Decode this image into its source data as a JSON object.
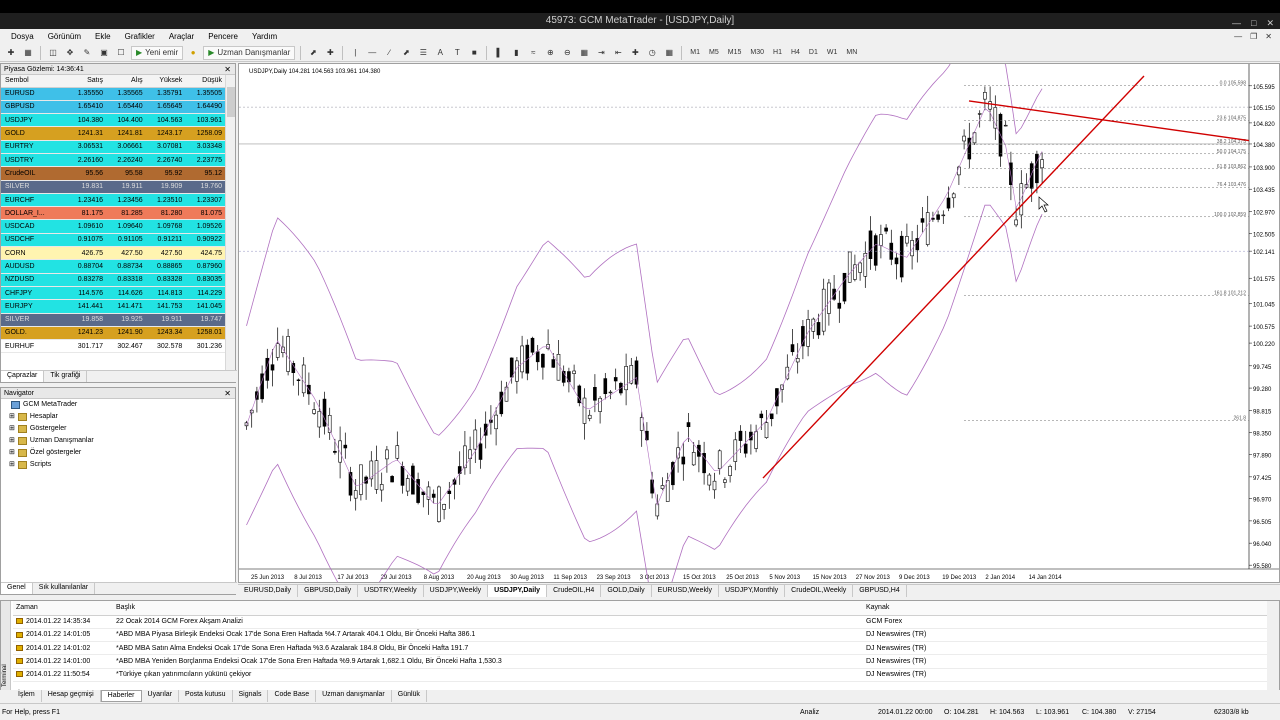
{
  "window": {
    "title": "45973: GCM MetaTrader - [USDJPY,Daily]"
  },
  "menu": [
    "Dosya",
    "Görünüm",
    "Ekle",
    "Grafikler",
    "Araçlar",
    "Pencere",
    "Yardım"
  ],
  "toolbar": {
    "new_order": "Yeni emir",
    "expert_advisors": "Uzman Danışmanlar",
    "timeframes": [
      "M1",
      "M5",
      "M15",
      "M30",
      "H1",
      "H4",
      "D1",
      "W1",
      "MN"
    ]
  },
  "market_watch": {
    "title": "Piyasa Gözlemi: 14:36:41",
    "headers": [
      "Sembol",
      "Satış",
      "Alış",
      "Yüksek",
      "Düşük"
    ],
    "rows": [
      {
        "sym": "EURUSD",
        "bid": "1.35550",
        "ask": "1.35565",
        "high": "1.35791",
        "low": "1.35505",
        "color": "#3fc0e8"
      },
      {
        "sym": "GBPUSD",
        "bid": "1.65410",
        "ask": "1.65440",
        "high": "1.65645",
        "low": "1.64490",
        "color": "#3fc0e8"
      },
      {
        "sym": "USDJPY",
        "bid": "104.380",
        "ask": "104.400",
        "high": "104.563",
        "low": "103.961",
        "color": "#22e3e3"
      },
      {
        "sym": "GOLD",
        "bid": "1241.31",
        "ask": "1241.81",
        "high": "1243.17",
        "low": "1258.09",
        "color": "#d6a020"
      },
      {
        "sym": "EURTRY",
        "bid": "3.06531",
        "ask": "3.06661",
        "high": "3.07081",
        "low": "3.03348",
        "color": "#22e3e3"
      },
      {
        "sym": "USDTRY",
        "bid": "2.26160",
        "ask": "2.26240",
        "high": "2.26740",
        "low": "2.23775",
        "color": "#22e3e3"
      },
      {
        "sym": "CrudeOIL",
        "bid": "95.56",
        "ask": "95.58",
        "high": "95.92",
        "low": "95.12",
        "color": "#b06a30"
      },
      {
        "sym": "SILVER",
        "bid": "19.831",
        "ask": "19.911",
        "high": "19.909",
        "low": "19.760",
        "color": "#5a6a8a"
      },
      {
        "sym": "EURCHF",
        "bid": "1.23416",
        "ask": "1.23456",
        "high": "1.23510",
        "low": "1.23307",
        "color": "#22e3e3"
      },
      {
        "sym": "DOLLAR_I...",
        "bid": "81.175",
        "ask": "81.285",
        "high": "81.280",
        "low": "81.075",
        "color": "#ef7a5a"
      },
      {
        "sym": "USDCAD",
        "bid": "1.09610",
        "ask": "1.09640",
        "high": "1.09768",
        "low": "1.09526",
        "color": "#22e3e3"
      },
      {
        "sym": "USDCHF",
        "bid": "0.91075",
        "ask": "0.91105",
        "high": "0.91211",
        "low": "0.90922",
        "color": "#22e3e3"
      },
      {
        "sym": "CORN",
        "bid": "426.75",
        "ask": "427.50",
        "high": "427.50",
        "low": "424.75",
        "color": "#fff4b0"
      },
      {
        "sym": "AUDUSD",
        "bid": "0.88704",
        "ask": "0.88734",
        "high": "0.88865",
        "low": "0.87960",
        "color": "#22e3e3"
      },
      {
        "sym": "NZDUSD",
        "bid": "0.83278",
        "ask": "0.83318",
        "high": "0.83328",
        "low": "0.83035",
        "color": "#22e3e3"
      },
      {
        "sym": "CHFJPY",
        "bid": "114.576",
        "ask": "114.626",
        "high": "114.813",
        "low": "114.229",
        "color": "#22e3e3"
      },
      {
        "sym": "EURJPY",
        "bid": "141.441",
        "ask": "141.471",
        "high": "141.753",
        "low": "141.045",
        "color": "#22e3e3"
      },
      {
        "sym": "SILVER",
        "bid": "19.858",
        "ask": "19.925",
        "high": "19.911",
        "low": "19.747",
        "color": "#5a6a8a"
      },
      {
        "sym": "GOLD.",
        "bid": "1241.23",
        "ask": "1241.90",
        "high": "1243.34",
        "low": "1258.01",
        "color": "#d6a020"
      },
      {
        "sym": "EURHUF",
        "bid": "301.717",
        "ask": "302.467",
        "high": "302.578",
        "low": "301.236",
        "color": "#ffffff"
      }
    ],
    "tabs": [
      "Çaprazlar",
      "Tik grafiği"
    ]
  },
  "navigator": {
    "title": "Navigator",
    "root": "GCM MetaTrader",
    "items": [
      "Hesaplar",
      "Göstergeler",
      "Uzman Danışmanlar",
      "Özel göstergeler",
      "Scripts"
    ],
    "tabs": [
      "Genel",
      "Sık kullanılanlar"
    ]
  },
  "chart": {
    "info": "USDJPY,Daily  104.281 104.563 103.961 104.380",
    "price_labels": [
      "105.595",
      "105.150",
      "104.820",
      "104.380",
      "103.900",
      "103.435",
      "102.970",
      "102.505",
      "102.141",
      "101.575",
      "101.045",
      "100.575",
      "100.220",
      "99.745",
      "99.280",
      "98.815",
      "98.350",
      "97.890",
      "97.425",
      "96.970",
      "96.505",
      "96.040",
      "95.580"
    ],
    "fib_labels": [
      "0.0 105.598",
      "23.6 104.875",
      "38.2 104.375",
      "50.0 104.175",
      "61.8 103.862",
      "76.4 103.476",
      "100.0 102.859",
      "161.8 101.212",
      "261.8"
    ],
    "date_labels": [
      "25 Jun 2013",
      "8 Jul 2013",
      "17 Jul 2013",
      "29 Jul 2013",
      "8 Aug 2013",
      "20 Aug 2013",
      "30 Aug 2013",
      "11 Sep 2013",
      "23 Sep 2013",
      "3 Oct 2013",
      "15 Oct 2013",
      "25 Oct 2013",
      "5 Nov 2013",
      "15 Nov 2013",
      "27 Nov 2013",
      "9 Dec 2013",
      "19 Dec 2013",
      "2 Jan 2014",
      "14 Jan 2014"
    ],
    "tabs": [
      "EURUSD,Daily",
      "GBPUSD,Daily",
      "USDTRY,Weekly",
      "USDJPY,Weekly",
      "USDJPY,Daily",
      "CrudeOIL,H4",
      "GOLD,Daily",
      "EURUSD,Weekly",
      "USDJPY,Monthly",
      "CrudeOIL,Weekly",
      "GBPUSD,H4"
    ],
    "active_tab": 4
  },
  "news": {
    "headers": [
      "Zaman",
      "Başlık",
      "Kaynak"
    ],
    "rows": [
      {
        "time": "2014.01.22 14:35:34",
        "title": "22 Ocak 2014 GCM Forex Akşam Analizi",
        "source": "GCM Forex"
      },
      {
        "time": "2014.01.22 14:01:05",
        "title": "*ABD MBA Piyasa Birleşik Endeksi Ocak 17'de Sona Eren Haftada %4.7 Artarak 404.1 Oldu, Bir Önceki Hafta 386.1",
        "source": "DJ Newswires (TR)"
      },
      {
        "time": "2014.01.22 14:01:02",
        "title": "*ABD MBA Satın Alma Endeksi Ocak 17'de Sona Eren Haftada %3.6 Azalarak 184.8 Oldu, Bir Önceki Hafta 191.7",
        "source": "DJ Newswires (TR)"
      },
      {
        "time": "2014.01.22 14:01:00",
        "title": "*ABD MBA Yeniden Borçlanma Endeksi Ocak 17'de Sona Eren Haftada %9.9 Artarak 1,682.1 Oldu, Bir Önceki Hafta 1,530.3",
        "source": "DJ Newswires (TR)"
      },
      {
        "time": "2014.01.22 11:50:54",
        "title": "*Türkiye çıkan yatırımcıların yükünü çekiyor",
        "source": "DJ Newswires (TR)"
      }
    ],
    "tabs": [
      "İşlem",
      "Hesap geçmişi",
      "Haberler",
      "Uyarılar",
      "Posta kutusu",
      "Signals",
      "Code Base",
      "Uzman danışmanlar",
      "Günlük"
    ],
    "active_tab": 2,
    "side_label": "Terminal"
  },
  "status": {
    "help": "For Help, press F1",
    "profile": "Analiz",
    "time": "2014.01.22 00:00",
    "open": "O: 104.281",
    "high": "H: 104.563",
    "low": "L: 103.961",
    "close": "C: 104.380",
    "volume": "V: 27154",
    "traffic": "62303/8 kb"
  },
  "colors": {
    "trendline": "#d00000",
    "bollinger": "#b070c0",
    "candle": "#000000",
    "bid_line": "#808080"
  }
}
